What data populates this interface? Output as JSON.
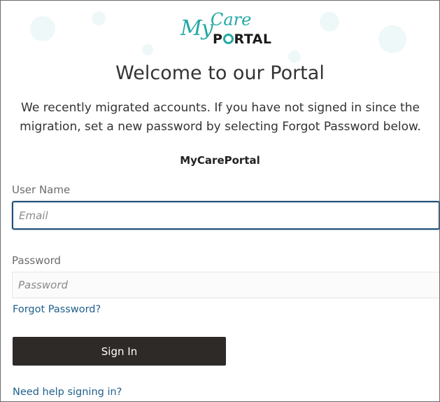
{
  "logo": {
    "my": "My",
    "care": "Care",
    "portal_before": "P",
    "portal_after": "RTAL"
  },
  "header": {
    "title": "Welcome to our Portal"
  },
  "intro": {
    "text": "We recently migrated accounts. If you have not signed in since the migration, set a new password by selecting Forgot Password below."
  },
  "portal_name": "MyCarePortal",
  "form": {
    "username_label": "User Name",
    "email_placeholder": "Email",
    "email_value": "",
    "password_label": "Password",
    "password_placeholder": "Password",
    "password_value": "",
    "forgot_password_link": "Forgot Password?",
    "signin_button": "Sign In",
    "help_link": "Need help signing in?"
  },
  "colors": {
    "brand_teal": "#24a9a4",
    "button_dark": "#2e2a28",
    "link_blue": "#1f5f8b",
    "focus_border": "#1f4e79"
  }
}
